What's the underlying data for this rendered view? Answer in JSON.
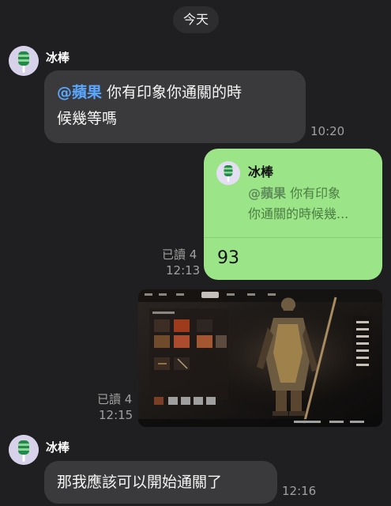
{
  "date_label": "今天",
  "colors": {
    "background": "#1f1f21",
    "incoming_bubble": "#3a3a3c",
    "outgoing_bubble": "#9be588",
    "mention": "#5aa7ff",
    "meta_text": "#a0a0a0"
  },
  "messages": [
    {
      "sender": "冰棒",
      "mention": "@蘋果",
      "line1": " 你有印象你通關的時",
      "line2": "候幾等嗎",
      "time": "10:20"
    },
    {
      "reply_to_name": "冰棒",
      "reply_mention": "@蘋果",
      "reply_line1": " 你有印象",
      "reply_line2": "你通關的時候幾...",
      "text": "93",
      "read": "已讀 4",
      "time": "12:13"
    },
    {
      "read": "已讀 4",
      "time": "12:15",
      "image_kind": "game-screenshot"
    },
    {
      "sender": "冰棒",
      "text": "那我應該可以開始通關了",
      "time": "12:16"
    }
  ],
  "icons": {
    "avatar": "popsicle-avatar-icon"
  }
}
